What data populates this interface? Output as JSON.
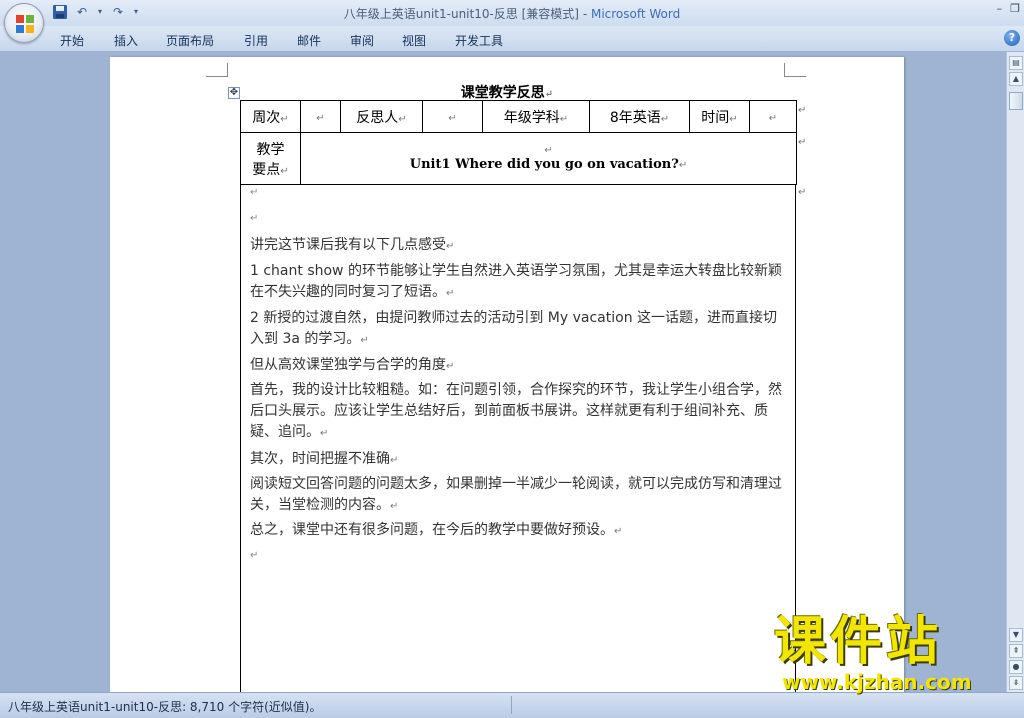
{
  "window": {
    "title": "八年级上英语unit1-unit10-反思 [兼容模式]",
    "title_sep": " - ",
    "app_name": "Microsoft Word",
    "controls": [
      "–",
      "❐"
    ]
  },
  "qat": {
    "save_icon": "save-icon",
    "undo_icon": "undo-icon",
    "redo_icon": "redo-icon"
  },
  "ribbon": {
    "tabs": [
      "开始",
      "插入",
      "页面布局",
      "引用",
      "邮件",
      "审阅",
      "视图",
      "开发工具"
    ],
    "help_label": "?"
  },
  "document": {
    "title": "课堂教学反思",
    "table": {
      "week_label": "周次",
      "reflector_label": "反思人",
      "grade_subject_label": "年级学科",
      "grade_subject_value": "8年英语",
      "time_label": "时间",
      "key_points_label_1": "教学",
      "key_points_label_2": "要点",
      "unit_title": "Unit1 Where did you go on vacation?"
    },
    "paragraphs": [
      "讲完这节课后我有以下几点感受",
      "1 chant show 的环节能够让学生自然进入英语学习氛围，尤其是幸运大转盘比较新颖在不失兴趣的同时复习了短语。",
      "2 新授的过渡自然，由提问教师过去的活动引到 My vacation 这一话题，进而直接切入到 3a 的学习。",
      "但从高效课堂独学与合学的角度",
      "首先，我的设计比较粗糙。如：在问题引领，合作探究的环节，我让学生小组合学，然后口头展示。应该让学生总结好后，到前面板书展讲。这样就更有利于组间补充、质疑、追问。",
      "其次，时间把握不准确",
      "阅读短文回答问题的问题太多，如果删掉一半减少一轮阅读，就可以完成仿写和清理过关，当堂检测的内容。",
      "总之，课堂中还有很多问题，在今后的教学中要做好预设。"
    ],
    "para_mark": "↵"
  },
  "status": {
    "text": "八年级上英语unit1-unit10-反思: 8,710 个字符(近似值)。"
  },
  "watermark": {
    "cn": "课件站",
    "url": "www.kjzhan.com"
  },
  "colors": {
    "title_bar": "#cddcf0",
    "app_blue": "#3b6fb6",
    "watermark": "#f2e500"
  }
}
